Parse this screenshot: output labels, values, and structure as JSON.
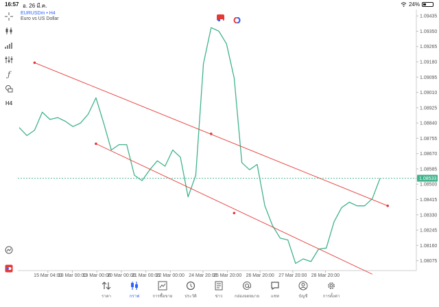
{
  "status": {
    "time": "16:57",
    "date": "อ. 26 มี.ค.",
    "battery": "24%"
  },
  "chart": {
    "symbol": "EURUSDm • H4",
    "description": "Euro vs US Dollar",
    "current_price": "1.08533",
    "price_ticks": [
      "1.09435",
      "1.09350",
      "1.09265",
      "1.09180",
      "1.09095",
      "1.09010",
      "1.08925",
      "1.08840",
      "1.08755",
      "1.08670",
      "1.08585",
      "1.08500",
      "1.08415",
      "1.08330",
      "1.08245",
      "1.08160",
      "1.08075"
    ],
    "time_ticks": [
      "15 Mar 04:00",
      "18 Mar 00:00",
      "19 Mar 00:00",
      "20 Mar 00:00",
      "21 Mar 00:00",
      "22 Mar 00:00",
      "24 Mar 20:00",
      "25 Mar 20:00",
      "26 Mar 20:00",
      "27 Mar 20:00",
      "28 Mar 20:00"
    ],
    "colors": {
      "line": "#3fb28a",
      "trend": "#e53935",
      "accent": "#2962ff",
      "price_tag": "#3fb28a"
    }
  },
  "chart_data": {
    "type": "line",
    "series": [
      {
        "values": [
          1.08815,
          1.0877,
          1.088,
          1.089,
          1.0886,
          1.0887,
          1.0885,
          1.0882,
          1.0884,
          1.0889,
          1.0898,
          1.0884,
          1.0869,
          1.0872,
          1.0872,
          1.0855,
          1.0852,
          1.0858,
          1.0863,
          1.086,
          1.0869,
          1.0865,
          1.0843,
          1.0855,
          1.0917,
          1.0937,
          1.0935,
          1.0928,
          1.0909,
          1.0862,
          1.0858,
          1.0861,
          1.0838,
          1.0827,
          1.082,
          1.0819,
          1.0806,
          1.08085,
          1.0807,
          1.0814,
          1.08145,
          1.0829,
          1.0837,
          1.084,
          1.0838,
          1.0838,
          1.0842,
          1.08533
        ]
      }
    ],
    "trendlines": [
      {
        "from": [
          2,
          1.09175
        ],
        "to": [
          48,
          1.0838
        ],
        "mid": [
          25,
          1.0878
        ]
      },
      {
        "from": [
          10,
          1.08725
        ],
        "to": [
          46,
          1.08
        ],
        "mid": [
          28,
          1.0834
        ]
      }
    ],
    "ylim": [
      1.0802,
      1.0947
    ],
    "grid": false
  },
  "nav": [
    {
      "label": "ราคา",
      "icon": "arrows-updown-icon"
    },
    {
      "label": "กราฟ",
      "icon": "candles-icon"
    },
    {
      "label": "การซื้อขาย",
      "icon": "trade-chart-icon"
    },
    {
      "label": "ประวัติ",
      "icon": "history-icon"
    },
    {
      "label": "ข่าว",
      "icon": "news-icon"
    },
    {
      "label": "กล่องจดหมาย",
      "icon": "mail-at-icon"
    },
    {
      "label": "แชท",
      "icon": "chat-icon"
    },
    {
      "label": "บัญชี",
      "icon": "account-icon"
    },
    {
      "label": "การตั้งค่า",
      "icon": "gear-icon"
    }
  ]
}
